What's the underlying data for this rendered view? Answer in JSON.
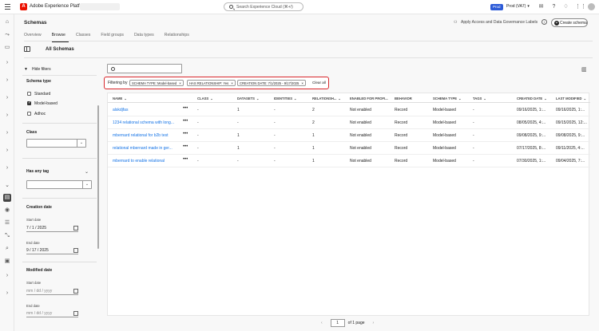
{
  "topbar": {
    "app_name": "Adobe Experience Platform",
    "logo_letter": "A",
    "search_placeholder": "Search Experience Cloud (⌘+/)",
    "env_badge": "Prod",
    "env_name": "Prod (VA7)"
  },
  "header": {
    "title": "Schemas",
    "gov_button": "Apply Access and Data Governance Labels",
    "create_button": "Create schema",
    "tabs": [
      "Overview",
      "Browse",
      "Classes",
      "Field groups",
      "Data types",
      "Relationships"
    ],
    "active_tab": "Browse",
    "section_title": "All Schemas"
  },
  "filters": {
    "hide_label": "Hide filters",
    "schema_type_label": "Schema type",
    "schema_types": [
      {
        "label": "Standard",
        "checked": false
      },
      {
        "label": "Model-based",
        "checked": true
      },
      {
        "label": "Adhoc",
        "checked": false
      }
    ],
    "class_label": "Class",
    "tag_label": "Has any tag",
    "creation_label": "Creation date",
    "start_label": "Start date",
    "end_label": "End date",
    "creation_start": "7 / 1 / 2025",
    "creation_end": "9 / 17 / 2025",
    "modified_label": "Modified date",
    "mod_start_label": "Start date",
    "mod_end_label": "End date",
    "date_placeholder": "mm / dd / yyyy"
  },
  "filterbar": {
    "label": "Filtering by",
    "pills": [
      "SCHEMA TYPE: Model-based",
      "HAS RELATIONSHIP: Yes",
      "CREATION DATE: 7/1/2025 - 9/17/2025"
    ],
    "clear_label": "Clear all"
  },
  "table": {
    "columns": [
      "NAME",
      "CLASS",
      "DATASETS",
      "IDENTITIES",
      "RELATIONSH...",
      "ENABLED FOR PROFI...",
      "BEHAVIOR",
      "SCHEMA TYPE",
      "TAGS",
      "CREATED DATE",
      "LAST MODIFIED"
    ],
    "rows": [
      {
        "name": "alskdjfas",
        "class": "-",
        "datasets": "1",
        "identities": "-",
        "relationships": "2",
        "profile": "Not enabled",
        "behavior": "Record",
        "type": "Model-based",
        "tags": "-",
        "created": "09/16/2025, 1:...",
        "modified": "09/16/2025, 1:..."
      },
      {
        "name": "1234 relational schema with long...",
        "class": "-",
        "datasets": "-",
        "identities": "-",
        "relationships": "2",
        "profile": "Not enabled",
        "behavior": "Record",
        "type": "Model-based",
        "tags": "-",
        "created": "08/05/2025, 4:...",
        "modified": "09/15/2025, 12:..."
      },
      {
        "name": "mbernard relational for b2b test",
        "class": "-",
        "datasets": "1",
        "identities": "-",
        "relationships": "1",
        "profile": "Not enabled",
        "behavior": "Record",
        "type": "Model-based",
        "tags": "-",
        "created": "09/08/2025, 9:...",
        "modified": "09/08/2025, 9:..."
      },
      {
        "name": "relational mbernard made in ger...",
        "class": "-",
        "datasets": "1",
        "identities": "-",
        "relationships": "1",
        "profile": "Not enabled",
        "behavior": "Record",
        "type": "Model-based",
        "tags": "-",
        "created": "07/17/2025, 8:...",
        "modified": "09/11/2025, 4:..."
      },
      {
        "name": "mbernard to enable relational",
        "class": "-",
        "datasets": "-",
        "identities": "-",
        "relationships": "1",
        "profile": "Not enabled",
        "behavior": "Record",
        "type": "Model-based",
        "tags": "-",
        "created": "07/30/2025, 1:...",
        "modified": "09/04/2025, 7:..."
      }
    ],
    "more_glyph": "•••"
  },
  "pager": {
    "page": "1",
    "of_label": "of 1 page",
    "prev": "‹",
    "next": "›"
  },
  "colors": {
    "accent": "#1473e6",
    "highlight": "#d8262b",
    "brand": "#eb1000"
  }
}
